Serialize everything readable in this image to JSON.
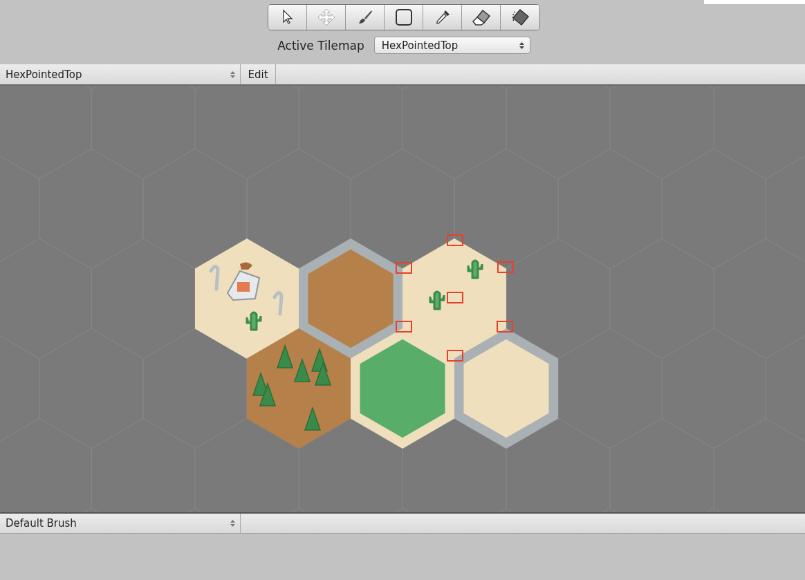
{
  "toolbar": {
    "tools": [
      {
        "kind": "select"
      },
      {
        "kind": "move"
      },
      {
        "kind": "paint"
      },
      {
        "kind": "box"
      },
      {
        "kind": "pick"
      },
      {
        "kind": "erase"
      },
      {
        "kind": "fill"
      }
    ]
  },
  "active_tilemap": {
    "label": "Active Tilemap",
    "value": "HexPointedTop"
  },
  "palette_bar": {
    "palette": "HexPointedTop",
    "edit_button": "Edit"
  },
  "tiles": [
    {
      "kind": "desert-town"
    },
    {
      "kind": "dirt-rock-border"
    },
    {
      "kind": "desert-cactus"
    },
    {
      "kind": "dirt-forest"
    },
    {
      "kind": "grass"
    },
    {
      "kind": "sand-rock-border"
    }
  ],
  "brush_bar": {
    "brush": "Default Brush"
  }
}
